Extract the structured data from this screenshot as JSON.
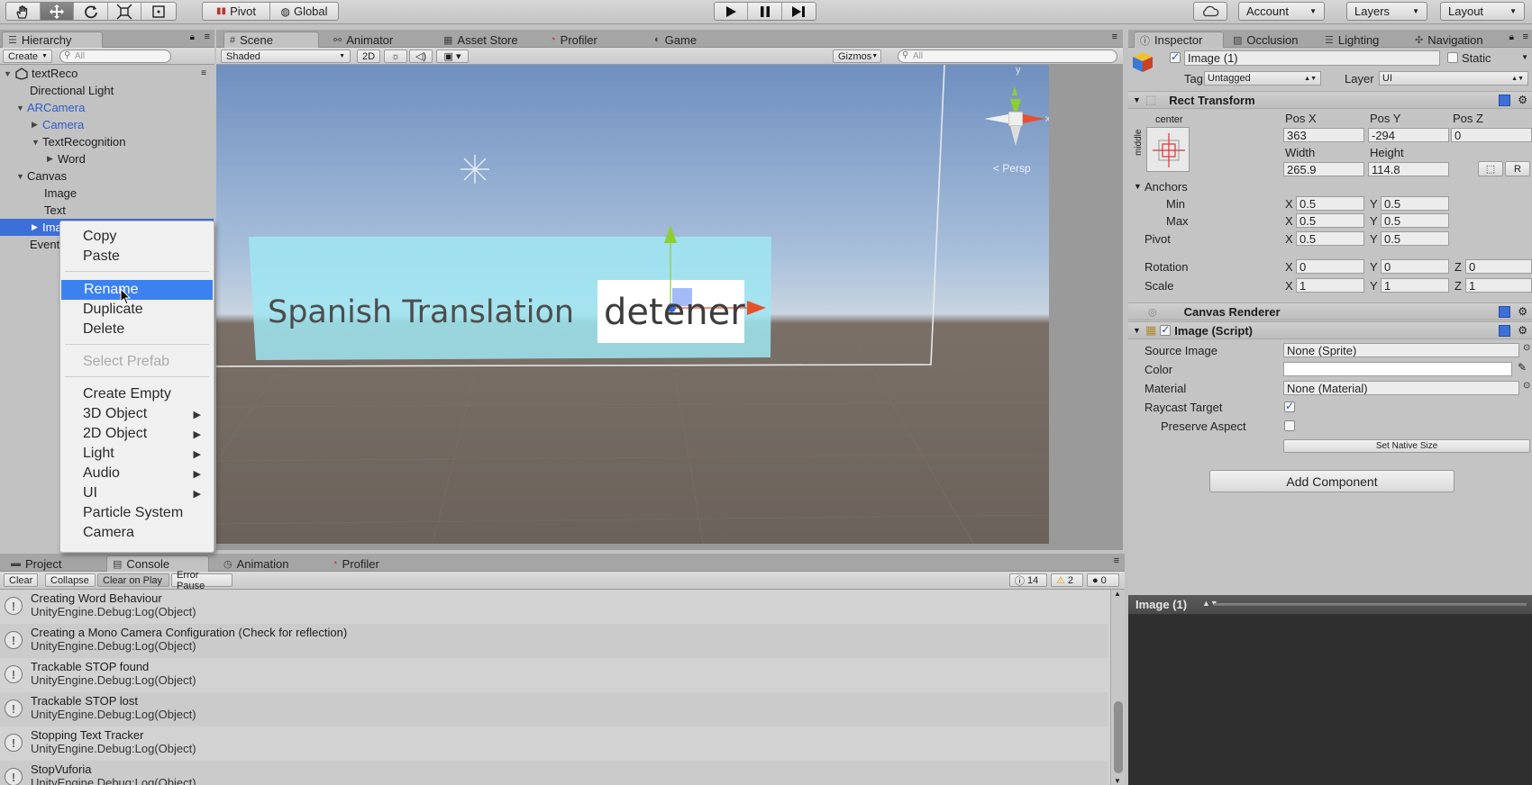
{
  "toolbar": {
    "pivot": "Pivot",
    "global": "Global",
    "account": "Account",
    "layers": "Layers",
    "layout": "Layout"
  },
  "hierarchy": {
    "tab": "Hierarchy",
    "create": "Create",
    "search_placeholder": "All",
    "scene_name": "textReco",
    "items": [
      {
        "label": "Directional Light"
      },
      {
        "label": "ARCamera"
      },
      {
        "label": "Camera"
      },
      {
        "label": "TextRecognition"
      },
      {
        "label": "Word"
      },
      {
        "label": "Canvas"
      },
      {
        "label": "Image"
      },
      {
        "label": "Text"
      },
      {
        "label": "Image (1)"
      },
      {
        "label": "EventSystem"
      }
    ]
  },
  "context_menu": {
    "copy": "Copy",
    "paste": "Paste",
    "rename": "Rename",
    "duplicate": "Duplicate",
    "delete": "Delete",
    "select_prefab": "Select Prefab",
    "create_empty": "Create Empty",
    "object_3d": "3D Object",
    "object_2d": "2D Object",
    "light": "Light",
    "audio": "Audio",
    "ui": "UI",
    "particle_system": "Particle System",
    "camera": "Camera"
  },
  "scene": {
    "tabs": [
      "Scene",
      "Animator",
      "Asset Store",
      "Profiler",
      "Game"
    ],
    "shading": "Shaded",
    "mode_2d": "2D",
    "gizmos": "Gizmos",
    "search_placeholder": "All",
    "persp": "Persp",
    "axis_x": "x",
    "axis_y": "y",
    "canvas_title": "Spanish Translation",
    "canvas_word": "detener"
  },
  "inspector": {
    "tabs": [
      "Inspector",
      "Occlusion",
      "Lighting",
      "Navigation"
    ],
    "object_name": "Image (1)",
    "static_label": "Static",
    "tag_label": "Tag",
    "tag_value": "Untagged",
    "layer_label": "Layer",
    "layer_value": "UI",
    "rect_transform": {
      "title": "Rect Transform",
      "anchor_h": "center",
      "anchor_v": "middle",
      "pos_x_label": "Pos X",
      "pos_y_label": "Pos Y",
      "pos_z_label": "Pos Z",
      "pos_x": "363",
      "pos_y": "-294",
      "pos_z": "0",
      "width_label": "Width",
      "height_label": "Height",
      "width": "265.9",
      "height": "114.8",
      "raw_btn": "R",
      "anchors_label": "Anchors",
      "min_label": "Min",
      "max_label": "Max",
      "pivot_label": "Pivot",
      "rotation_label": "Rotation",
      "scale_label": "Scale",
      "x": "X",
      "y": "Y",
      "z": "Z",
      "min_x": "0.5",
      "min_y": "0.5",
      "max_x": "0.5",
      "max_y": "0.5",
      "pivot_x": "0.5",
      "pivot_y": "0.5",
      "rot_x": "0",
      "rot_y": "0",
      "rot_z": "0",
      "scale_x": "1",
      "scale_y": "1",
      "scale_z": "1"
    },
    "canvas_renderer": {
      "title": "Canvas Renderer"
    },
    "image_script": {
      "title": "Image (Script)",
      "source_image_label": "Source Image",
      "source_image": "None (Sprite)",
      "color_label": "Color",
      "material_label": "Material",
      "material": "None (Material)",
      "raycast_label": "Raycast Target",
      "preserve_label": "Preserve Aspect",
      "set_native": "Set Native Size"
    },
    "add_component": "Add Component",
    "preview_title": "Image (1)"
  },
  "console": {
    "tabs": [
      "Project",
      "Console",
      "Animation",
      "Profiler"
    ],
    "buttons": [
      "Clear",
      "Collapse",
      "Clear on Play",
      "Error Pause"
    ],
    "info_count": "14",
    "warn_count": "2",
    "error_count": "0",
    "logs": [
      {
        "msg": "Creating Word Behaviour",
        "src": "UnityEngine.Debug:Log(Object)"
      },
      {
        "msg": "Creating a Mono Camera Configuration (Check for reflection)",
        "src": "UnityEngine.Debug:Log(Object)"
      },
      {
        "msg": "Trackable STOP found",
        "src": "UnityEngine.Debug:Log(Object)"
      },
      {
        "msg": "Trackable STOP lost",
        "src": "UnityEngine.Debug:Log(Object)"
      },
      {
        "msg": "Stopping Text Tracker",
        "src": "UnityEngine.Debug:Log(Object)"
      },
      {
        "msg": "StopVuforia",
        "src": "UnityEngine.Debug:Log(Object)"
      }
    ]
  },
  "colors": {
    "selection": "#3d6fd8",
    "menu_highlight": "#3b82f0",
    "canvas_panel": "#9fe6f2",
    "gizmo_green": "#8ccf2e",
    "gizmo_red": "#e8502a"
  }
}
